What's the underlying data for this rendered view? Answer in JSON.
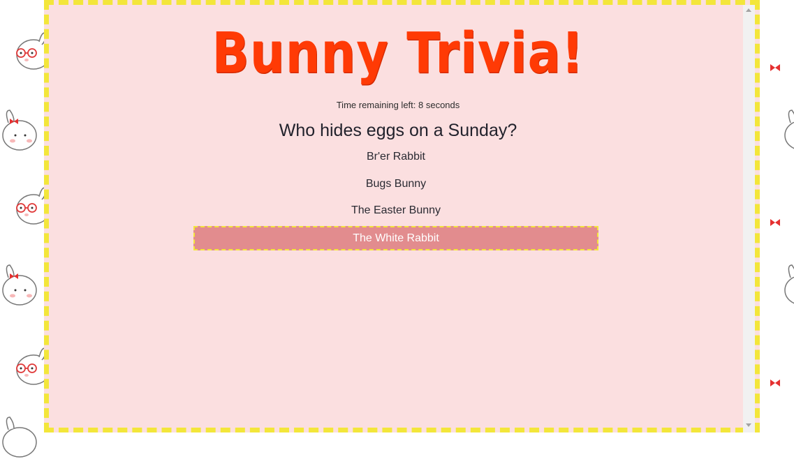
{
  "page": {
    "title": "Bunny Trivia!",
    "timer_text": "Time remaining left: 8 seconds",
    "question": "Who hides eggs on a Sunday?",
    "answers": [
      {
        "label": "Br'er Rabbit",
        "selected": false
      },
      {
        "label": "Bugs Bunny",
        "selected": false
      },
      {
        "label": "The Easter Bunny",
        "selected": false
      },
      {
        "label": "The White Rabbit",
        "selected": true
      }
    ]
  },
  "colors": {
    "title": "#ff3a05",
    "panel_background": "#fbdfe0",
    "frame_border": "#f3e63a",
    "selected_answer": "#e28c8e"
  },
  "icons": {
    "background_decoration": "bunny-icon",
    "bow_decoration": "bow-icon"
  }
}
